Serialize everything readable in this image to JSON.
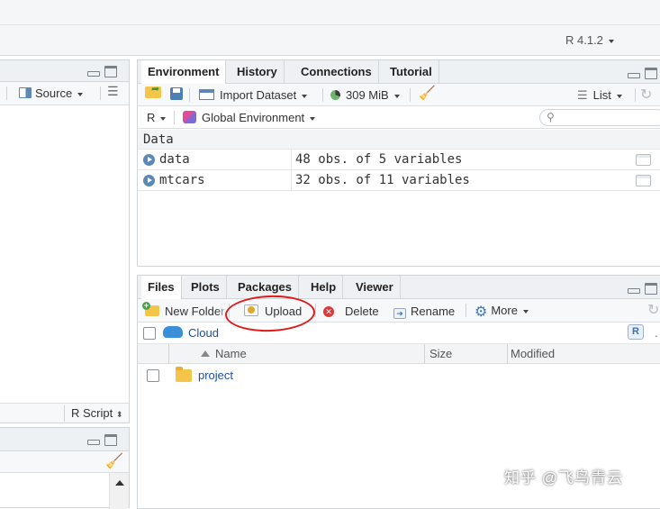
{
  "app": {
    "r_version": "R 4.1.2"
  },
  "source_pane": {
    "toolbar": {
      "source_label": "Source"
    },
    "status": {
      "file_type": "R Script"
    }
  },
  "env_pane": {
    "tabs": [
      "Environment",
      "History",
      "Connections",
      "Tutorial"
    ],
    "toolbar": {
      "import_label": "Import Dataset",
      "memory_label": "309 MiB",
      "view_label": "List"
    },
    "scope": {
      "language": "R",
      "environment": "Global Environment",
      "search_placeholder": ""
    },
    "section_header": "Data",
    "rows": [
      {
        "name": "data",
        "value": "48 obs. of 5 variables"
      },
      {
        "name": "mtcars",
        "value": "32 obs. of 11 variables"
      }
    ]
  },
  "files_pane": {
    "tabs": [
      "Files",
      "Plots",
      "Packages",
      "Help",
      "Viewer"
    ],
    "toolbar": {
      "new_folder": "New Folder",
      "upload": "Upload",
      "delete": "Delete",
      "rename": "Rename",
      "more": "More"
    },
    "path": "Cloud",
    "columns": {
      "name": "Name",
      "size": "Size",
      "modified": "Modified"
    },
    "rows": [
      {
        "name": "project",
        "size": "",
        "modified": ""
      }
    ]
  },
  "watermark": "知乎 @飞鸟青云",
  "colors": {
    "highlight_red": "#e01b1b",
    "link_blue": "#1f4e9e",
    "play_blue": "#5b88b7"
  }
}
